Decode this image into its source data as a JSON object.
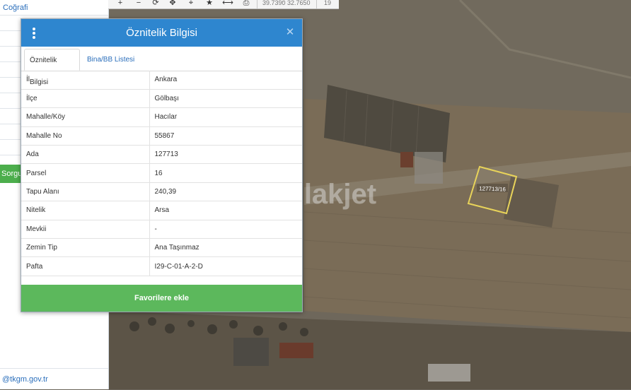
{
  "sidebar": {
    "items": [
      "Coğrafi"
    ],
    "query_button": "Sorgula",
    "footer": "@tkgm.gov.tr"
  },
  "toolbar": {
    "icons": [
      "plus-icon",
      "minus-icon",
      "refresh-icon",
      "move-icon",
      "locate-icon",
      "star-icon",
      "measure-icon",
      "print-icon"
    ],
    "coord_lat": "39.7390",
    "coord_lon": "32.7650",
    "zoom": "19"
  },
  "popup": {
    "title": "Öznitelik Bilgisi",
    "tabs": [
      {
        "label": "Öznitelik Bilgisi"
      },
      {
        "label": "Bina/BB Listesi"
      }
    ],
    "rows": [
      {
        "key": "İl",
        "value": "Ankara"
      },
      {
        "key": "İlçe",
        "value": "Gölbaşı"
      },
      {
        "key": "Mahalle/Köy",
        "value": "Hacılar"
      },
      {
        "key": "Mahalle No",
        "value": "55867"
      },
      {
        "key": "Ada",
        "value": "127713"
      },
      {
        "key": "Parsel",
        "value": "16"
      },
      {
        "key": "Tapu Alanı",
        "value": "240,39"
      },
      {
        "key": "Nitelik",
        "value": "Arsa"
      },
      {
        "key": "Mevkii",
        "value": "-"
      },
      {
        "key": "Zemin Tip",
        "value": "Ana Taşınmaz"
      },
      {
        "key": "Pafta",
        "value": "I29-C-01-A-2-D"
      }
    ],
    "favorite_button": "Favorilere ekle"
  },
  "map": {
    "parcel_label": "127713/16",
    "watermark": "emlakjet"
  },
  "colors": {
    "header": "#2e86cf",
    "button": "#5cb85c",
    "parcel_outline": "#e8d35a"
  }
}
